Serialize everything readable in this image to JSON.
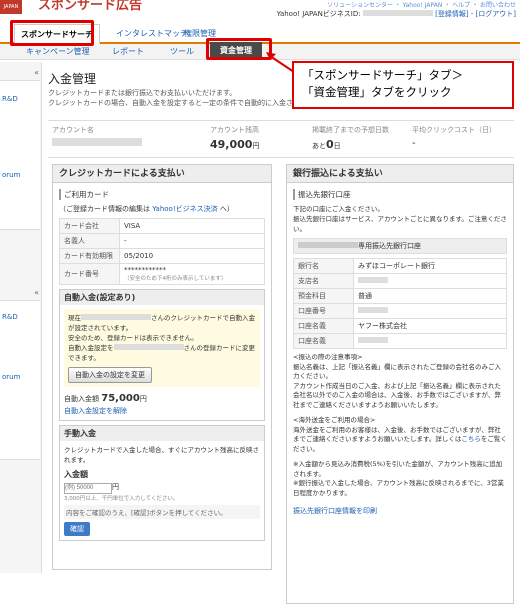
{
  "header": {
    "brand": "スポンサード広告",
    "logo": "JAPAN",
    "top_links": "ソリューションセンター ・ Yahoo! JAPAN ・ ヘルプ ・ お問い合わせ",
    "user_label": "Yahoo! JAPANビジネスID:",
    "user_id": "",
    "links": "[登録情報] - [ログアウト]"
  },
  "tabs": [
    {
      "label": "スポンサードサーチ"
    },
    {
      "label": "インタレストマッチ"
    },
    {
      "label": "権限管理"
    }
  ],
  "subtabs": [
    {
      "label": "キャンペーン管理"
    },
    {
      "label": "レポート"
    },
    {
      "label": "ツール"
    },
    {
      "label": "資金管理"
    }
  ],
  "sidebar": {
    "collapse": "«",
    "items": [
      "R&D",
      "orum",
      "R&D",
      "orum"
    ]
  },
  "page": {
    "title": "入金管理",
    "desc1": "クレジットカードまたは銀行振込でお支払いいただけます。",
    "desc2": "クレジットカードの場合、自動入金を設定すると一定の条件で自動的に入金されます。"
  },
  "summary": {
    "account_name_label": "アカウント名",
    "account_name": "",
    "balance_label": "アカウント残高",
    "balance": "49,000",
    "balance_unit": "円",
    "days_label": "掲載終了までの予想日数",
    "days_prefix": "あと",
    "days": "0",
    "days_unit": "日",
    "cpc_label": "平均クリックコスト（日）",
    "cpc": "-"
  },
  "credit": {
    "title": "クレジットカードによる支払い",
    "card_section": "ご利用カード",
    "card_note_prefix": "（ご登録カード情報の編集は ",
    "card_note_link": "Yahoo!ビジネス決済",
    "card_note_suffix": " へ）",
    "rows": [
      {
        "k": "カード会社",
        "v": "VISA"
      },
      {
        "k": "名義人",
        "v": "-"
      },
      {
        "k": "カード有効期限",
        "v": "05/2010"
      },
      {
        "k": "カード番号",
        "v": "************"
      }
    ],
    "card_number_note": "（安全のため下4桁のみ表示しています）",
    "auto_title": "自動入金(設定あり)",
    "auto_text1": "現在",
    "auto_text2": "さんのクレジットカードで自動入金が設定されています。",
    "auto_text3": "安全のため、登録カードは表示できません。",
    "auto_text4": "自動入金設定を",
    "auto_text5": "さんの登録カードに変更できます。",
    "auto_button": "自動入金の設定を変更",
    "auto_amount_label": "自動入金額",
    "auto_amount": "75,000",
    "auto_amount_unit": "円",
    "auto_cancel": "自動入金設定を解除",
    "manual_title": "手動入金",
    "manual_text": "クレジットカードで入金した場合、すぐにアカウント残高に反映されます。",
    "amount_label": "入金額",
    "amount_placeholder": "(例) 50000",
    "amount_unit": "円",
    "amount_note": "3,000円以上、千円単位で入力してください。",
    "confirm_text": "内容をご確認のうえ、[確認]ボタンを押してください。",
    "confirm_button": "確認"
  },
  "bank": {
    "title": "銀行振込による支払い",
    "section": "振込先銀行口座",
    "intro1": "下記の口座にご入金ください。",
    "intro2": "振込先銀行口座はサービス、アカウントごとに異なります。ご注意ください。",
    "account_title": "専用振込先銀行口座",
    "rows": [
      {
        "k": "銀行名",
        "v": "みずほコーポレート銀行"
      },
      {
        "k": "支店名",
        "v": ""
      },
      {
        "k": "預金科目",
        "v": "普通"
      },
      {
        "k": "口座番号",
        "v": ""
      },
      {
        "k": "口座名義",
        "v": "ヤフー株式会社"
      },
      {
        "k": "口座名義",
        "v": ""
      }
    ],
    "notes_head": "<振込の際の注意事項>",
    "notes1": "振込名義は、上記「振込名義」欄に表示されたご登録の会社名のみご入力ください。",
    "notes2": "アカウント作成当日のご入金、および上記「振込名義」欄に表示された会社名以外でのご入金の場合は、入金後、お手数ではございますが、弊社までご連絡くださいますようお願いいたします。",
    "overseas_head": "<海外送金をご利用の場合>",
    "overseas1": "海外送金をご利用のお客様は、入金後、お手数ではございますが、弊社までご連絡くださいますようお願いいたします。詳しくは",
    "overseas_link": "こちら",
    "overseas2": "をご覧ください。",
    "tax": "※入金額から見込み消費税(5%)を引いた金額が、アカウント残高に追加されます。",
    "timing": "※銀行振込で入金した場合、アカウント残高に反映されるまでに、3営業日程度かかります。",
    "print_link": "振込先銀行口座情報を印刷"
  },
  "callout": {
    "line1": "「スポンサードサーチ」タブ＞",
    "line2": "「資金管理」タブをクリック"
  },
  "colors": {
    "accent": "#e07b00",
    "highlight": "#e00000",
    "link": "#1a5fb4"
  }
}
